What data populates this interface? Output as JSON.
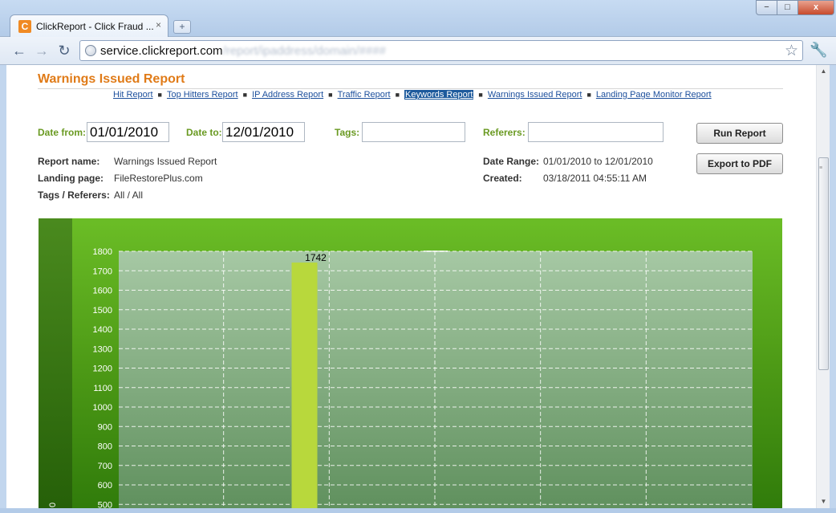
{
  "browser": {
    "tab_title": "ClickReport - Click Fraud ...",
    "tab_close": "×",
    "newtab": "+",
    "url_host": "service.clickreport.com",
    "url_path": "/report/ipaddress/domain/####",
    "window_min": "−",
    "window_max": "□",
    "window_close": "x",
    "back": "←",
    "forward": "→",
    "reload": "↻",
    "star": "☆",
    "wrench": "🔧",
    "favicon_letter": "C"
  },
  "report": {
    "title": "Warnings Issued Report",
    "nav": [
      {
        "label": "Hit Report",
        "active": false
      },
      {
        "label": "Top Hitters Report",
        "active": false
      },
      {
        "label": "IP Address Report",
        "active": false
      },
      {
        "label": "Traffic Report",
        "active": false
      },
      {
        "label": "Keywords Report",
        "active": true
      },
      {
        "label": "Warnings Issued Report",
        "active": false
      },
      {
        "label": "Landing Page Monitor Report",
        "active": false
      }
    ],
    "filters": {
      "date_from_label": "Date from:",
      "date_from_value": "01/01/2010",
      "date_to_label": "Date to:",
      "date_to_value": "12/01/2010",
      "tags_label": "Tags:",
      "tags_value": "",
      "referers_label": "Referers:",
      "referers_value": ""
    },
    "buttons": {
      "run": "Run Report",
      "export": "Export to PDF"
    },
    "meta": {
      "report_name_label": "Report name:",
      "report_name_value": "Warnings Issued Report",
      "landing_page_label": "Landing page:",
      "landing_page_value": "FileRestorePlus.com",
      "tags_referers_label": "Tags / Referers:",
      "tags_referers_value": "All / All",
      "date_range_label": "Date Range:",
      "date_range_value": "01/01/2010 to 12/01/2010",
      "created_label": "Created:",
      "created_value": "03/18/2011 04:55:11 AM"
    }
  },
  "chart_data": {
    "type": "bar",
    "ylim": [
      0,
      1800
    ],
    "yticks": [
      500,
      600,
      700,
      800,
      900,
      1000,
      1100,
      1200,
      1300,
      1400,
      1500,
      1600,
      1700,
      1800
    ],
    "left_strip_label": "0",
    "bars": [
      {
        "slot": 2,
        "value": 1742,
        "label": "1742"
      }
    ],
    "slots": 6,
    "grid": true,
    "colors": {
      "bar": "#b8d83c",
      "plot_top": "#a6c8a4",
      "plot_bottom": "#5e8f5c"
    }
  }
}
